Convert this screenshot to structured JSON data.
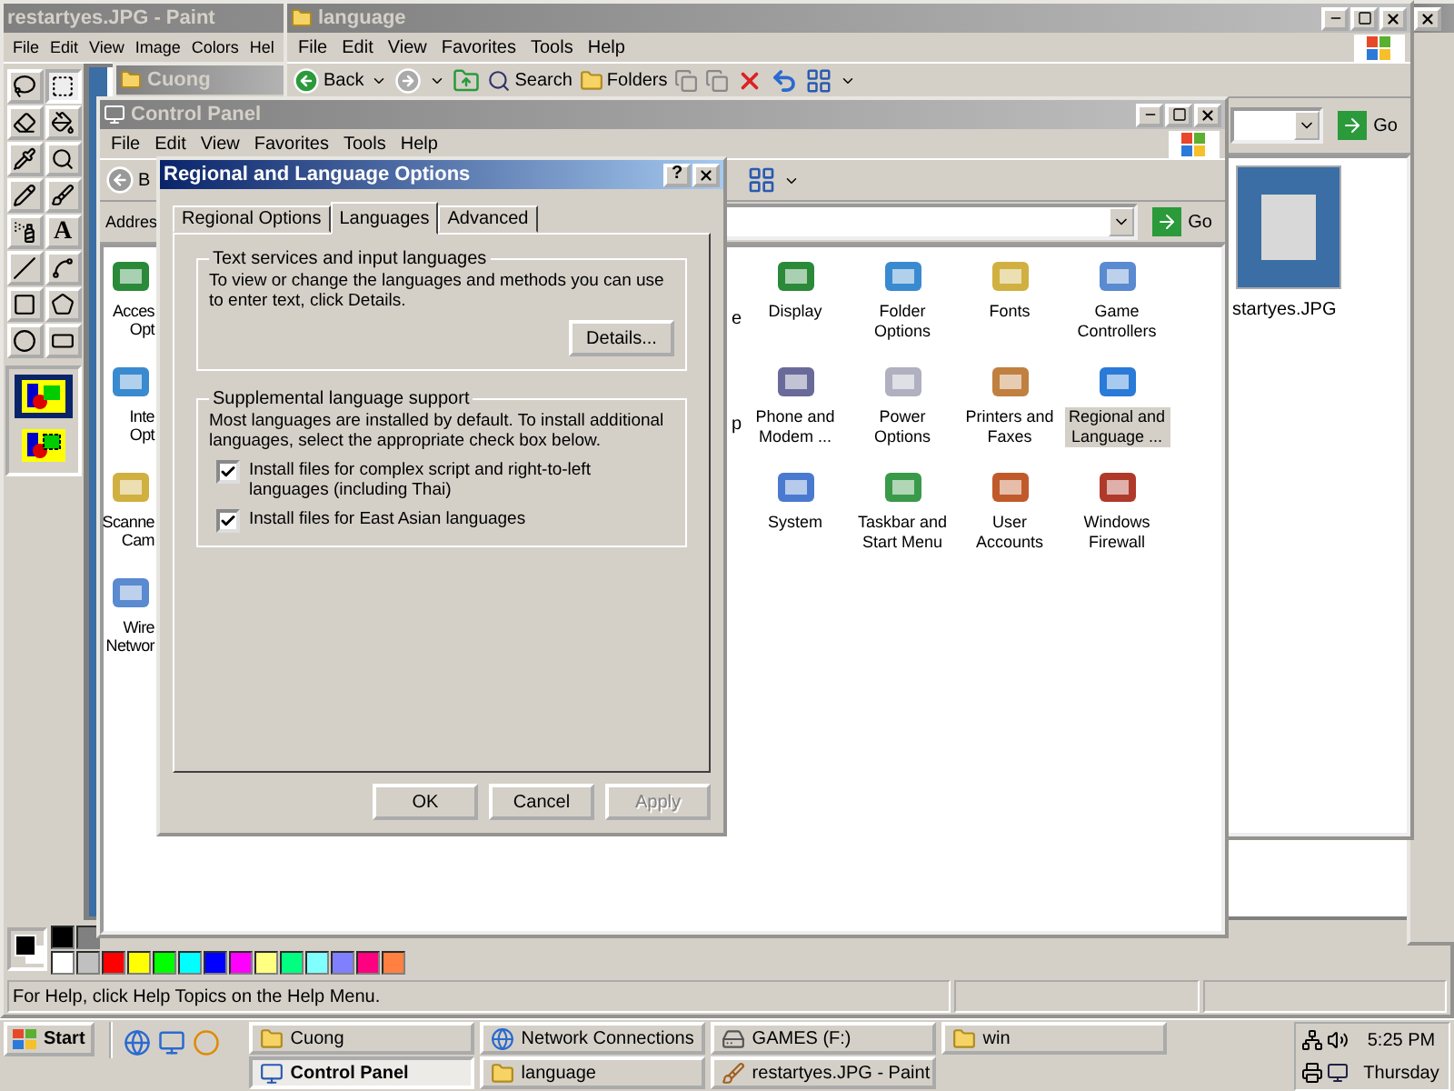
{
  "paint": {
    "title": "restartyes.JPG - Paint",
    "menu": [
      "File",
      "Edit",
      "View",
      "Image",
      "Colors",
      "Hel"
    ],
    "tools": [
      {
        "selected": false
      },
      {
        "selected": true
      },
      {
        "selected": false
      },
      {
        "selected": false
      },
      {
        "selected": false
      },
      {
        "selected": false
      },
      {
        "selected": false
      },
      {
        "selected": false
      },
      {
        "selected": false
      },
      {
        "selected": false,
        "glyph": "A"
      },
      {
        "selected": false
      },
      {
        "selected": false
      },
      {
        "selected": false
      },
      {
        "selected": false
      },
      {
        "selected": false
      },
      {
        "selected": false
      }
    ],
    "options": [
      {
        "selected": true
      },
      {
        "selected": false
      }
    ],
    "palette_top": [
      {
        "color": "#000000"
      },
      {
        "color": "#808080"
      }
    ],
    "palette_bottom": [
      {
        "color": "#ffffff"
      },
      {
        "color": "#c0c0c0"
      },
      {
        "color": "#ff0000"
      },
      {
        "color": "#ffff00"
      },
      {
        "color": "#00ff00"
      },
      {
        "color": "#00ffff"
      },
      {
        "color": "#0000ff"
      },
      {
        "color": "#ff00ff"
      },
      {
        "color": "#ffff80"
      },
      {
        "color": "#00ff80"
      },
      {
        "color": "#80ffff"
      },
      {
        "color": "#8080ff"
      },
      {
        "color": "#ff0080"
      },
      {
        "color": "#ff8040"
      }
    ],
    "status": "For Help, click Help Topics on the Help Menu."
  },
  "back_window": {
    "title": "Cuong"
  },
  "language_window": {
    "title": "language",
    "menu": [
      "File",
      "Edit",
      "View",
      "Favorites",
      "Tools",
      "Help"
    ],
    "back": "Back",
    "search": "Search",
    "folders": "Folders",
    "go": "Go",
    "file_name": "startyes.JPG"
  },
  "control_panel": {
    "title": "Control Panel",
    "menu": [
      "File",
      "Edit",
      "View",
      "Favorites",
      "Tools",
      "Help"
    ],
    "back": "B",
    "address_label": "Addres",
    "go": "Go",
    "left_items": [
      "Acces\nOpt",
      "Inte\nOpt",
      "Scanne\nCam",
      "Wire\nNetwor"
    ],
    "fragments": [
      "e",
      "p"
    ],
    "items": [
      {
        "label": "Display",
        "selected": false
      },
      {
        "label": "Folder Options",
        "selected": false
      },
      {
        "label": "Fonts",
        "selected": false
      },
      {
        "label": "Game Controllers",
        "selected": false
      },
      {
        "label": "Phone and Modem ...",
        "selected": false
      },
      {
        "label": "Power Options",
        "selected": false
      },
      {
        "label": "Printers and Faxes",
        "selected": false
      },
      {
        "label": "Regional and Language ...",
        "selected": true
      },
      {
        "label": "System",
        "selected": false
      },
      {
        "label": "Taskbar and Start Menu",
        "selected": false
      },
      {
        "label": "User Accounts",
        "selected": false
      },
      {
        "label": "Windows Firewall",
        "selected": false
      }
    ]
  },
  "dialog": {
    "title": "Regional and Language Options",
    "help": "?",
    "tabs": [
      {
        "label": "Regional Options",
        "selected": false
      },
      {
        "label": "Languages",
        "selected": true
      },
      {
        "label": "Advanced",
        "selected": false
      }
    ],
    "group1": {
      "legend": "Text services and input languages",
      "text": "To view or change the languages and methods you can use to enter text, click Details.",
      "button": "Details..."
    },
    "group2": {
      "legend": "Supplemental language support",
      "text": "Most languages are installed by default. To install additional languages, select the appropriate check box below.",
      "checkboxes": [
        {
          "label": "Install files for complex script and right-to-left languages (including Thai)",
          "checked": true
        },
        {
          "label": "Install files for East Asian languages",
          "checked": true
        }
      ]
    },
    "buttons": [
      {
        "label": "OK",
        "disabled": false
      },
      {
        "label": "Cancel",
        "disabled": false
      },
      {
        "label": "Apply",
        "disabled": true
      }
    ]
  },
  "taskbar": {
    "start": "Start",
    "buttons": [
      {
        "label": "Cuong",
        "selected": false
      },
      {
        "label": "Network Connections",
        "selected": false
      },
      {
        "label": "GAMES (F:)",
        "selected": false
      },
      {
        "label": "win",
        "selected": false
      },
      {
        "label": "Control Panel",
        "selected": true
      },
      {
        "label": "language",
        "selected": false
      },
      {
        "label": "restartyes.JPG - Paint",
        "selected": false
      }
    ],
    "time": "5:25 PM",
    "day": "Thursday"
  }
}
